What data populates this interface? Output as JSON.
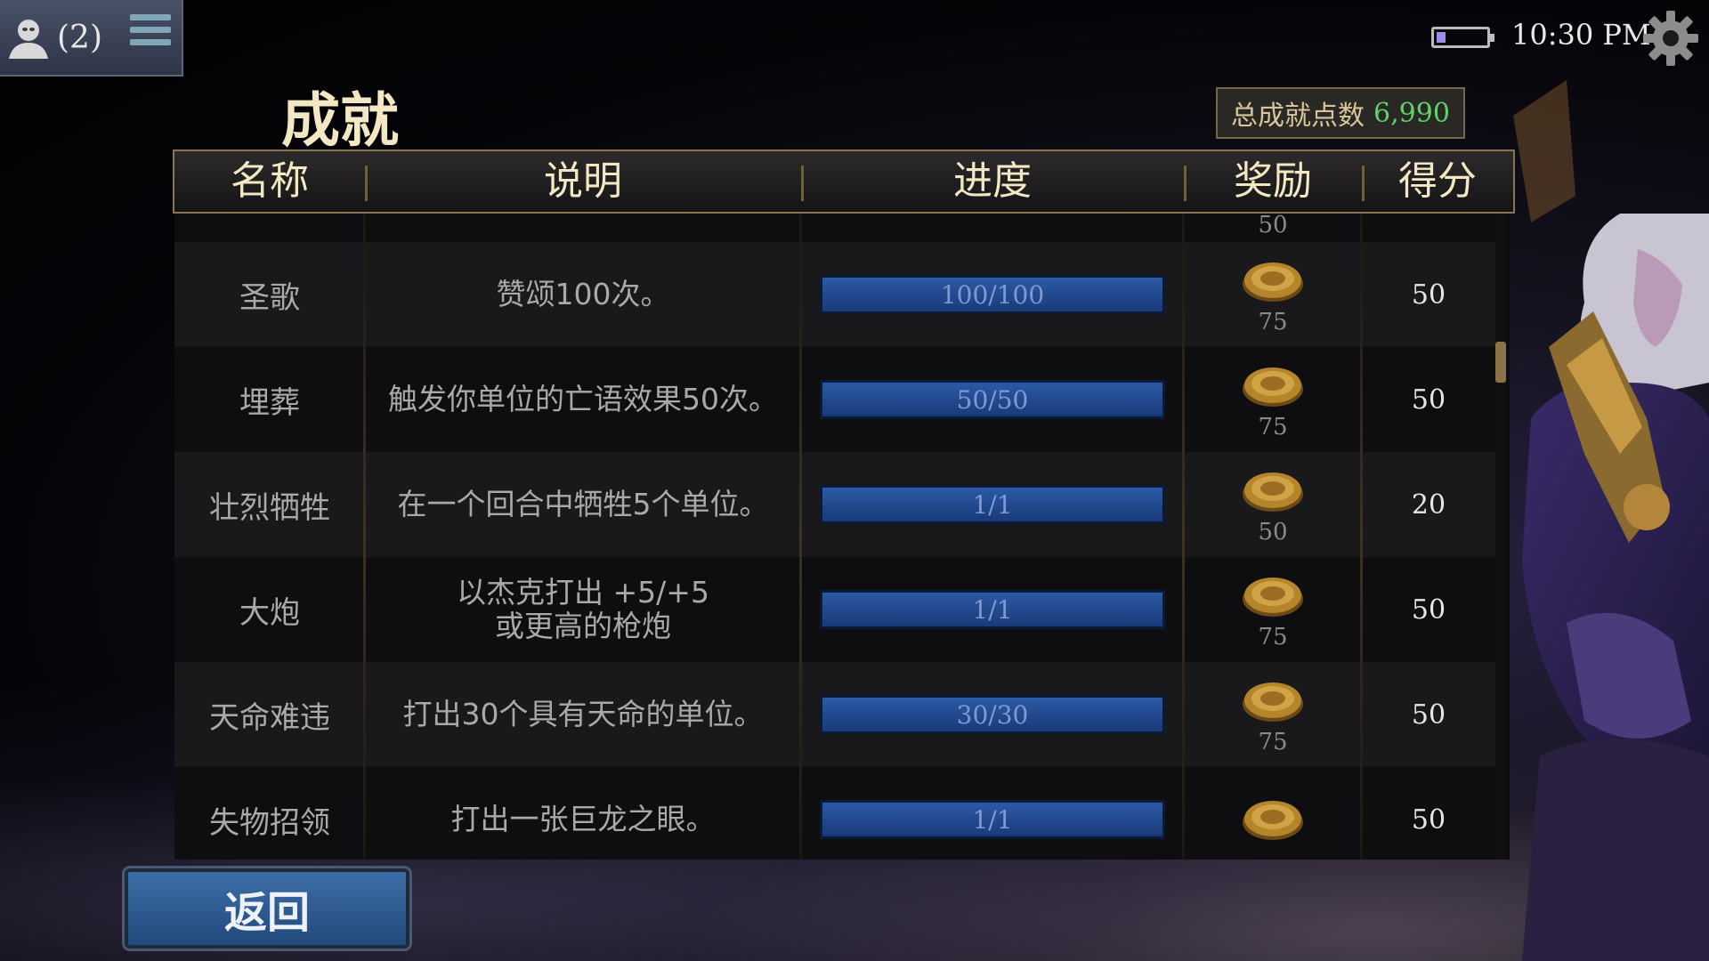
{
  "status_bar": {
    "friend_count": "(2)",
    "time": "10:30 PM"
  },
  "page": {
    "title": "成就",
    "total_label": "总成就点数",
    "total_value": "6,990"
  },
  "table": {
    "headers": [
      "名称",
      "说明",
      "进度",
      "奖励",
      "得分"
    ],
    "partial_top_reward": "50",
    "rows": [
      {
        "name": "圣歌",
        "description": "赞颂100次。",
        "progress": "100/100",
        "reward": "75",
        "score": "50"
      },
      {
        "name": "埋葬",
        "description": "触发你单位的亡语效果50次。",
        "progress": "50/50",
        "reward": "75",
        "score": "50"
      },
      {
        "name": "壮烈牺牲",
        "description": "在一个回合中牺牲5个单位。",
        "progress": "1/1",
        "reward": "50",
        "score": "20"
      },
      {
        "name": "大炮",
        "description": "以杰克打出 +5/+5 或更高的枪炮",
        "progress": "1/1",
        "reward": "75",
        "score": "50"
      },
      {
        "name": "天命难违",
        "description": "打出30个具有天命的单位。",
        "progress": "30/30",
        "reward": "75",
        "score": "50"
      },
      {
        "name": "失物招领",
        "description": "打出一张巨龙之眼。",
        "progress": "1/1",
        "reward": "",
        "score": "50"
      }
    ]
  },
  "buttons": {
    "back_label": "返回"
  },
  "icons": {
    "player": "user-silhouette-icon",
    "menu": "hamburger-menu-icon",
    "battery": "battery-icon",
    "settings": "gear-icon",
    "reward": "gold-coin-icon"
  },
  "colors": {
    "title": "#f3e7c4",
    "total_value": "#5fd16a",
    "progress_bar": "#2c5aa6",
    "back_button": "#3d6ea8",
    "gold_border": "#8a7551"
  }
}
